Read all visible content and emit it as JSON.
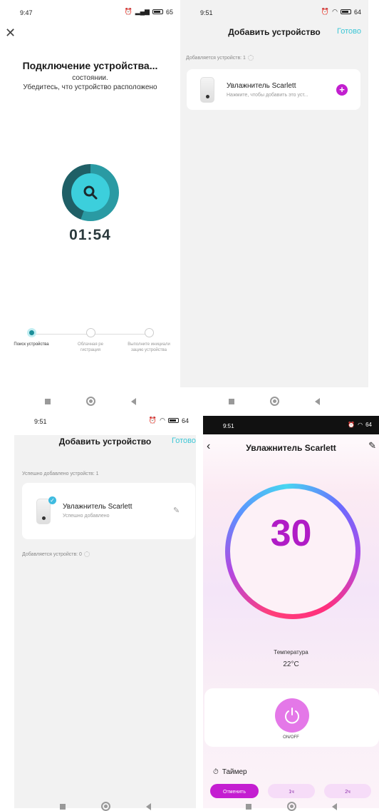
{
  "screen1": {
    "status_time": "9:47",
    "status_battery": "65",
    "title": "Подключение устройства...",
    "subtitle_line1": "состоянии.",
    "subtitle_line2": "Убедитесь, что устройство расположено",
    "countdown": "01:54",
    "steps": [
      {
        "label": "Поиск устройства",
        "state": "active"
      },
      {
        "label": "Облачная ре гистрация",
        "state": "pending"
      },
      {
        "label": "Выполните инициали зацию устройства",
        "state": "pending"
      }
    ]
  },
  "screen2": {
    "status_time": "9:51",
    "status_battery": "64",
    "header_title": "Добавить устройство",
    "done_label": "Готово",
    "adding_label": "Добавляется устройств: 1",
    "device_name": "Увлажнитель Scarlett",
    "device_hint": "Нажмите, чтобы добавить это уст...",
    "add_icon": "plus-icon"
  },
  "screen3": {
    "status_time": "9:51",
    "status_battery": "64",
    "header_title": "Добавить устройство",
    "done_label": "Готово",
    "success_label": "Успешно добавлено устройств: 1",
    "device_name": "Увлажнитель Scarlett",
    "device_status": "Успешно добавлено",
    "adding_label": "Добавляется устройств: 0"
  },
  "screen4": {
    "status_time": "9:51",
    "status_battery": "64",
    "title": "Увлажнитель Scarlett",
    "humidity_value": "30",
    "temp_label": "Температура",
    "temp_value": "22°C",
    "power_label": "ON/OFF",
    "timer_label": "Таймер",
    "timer_options": [
      "Отменить",
      "1ч",
      "2ч"
    ],
    "accent_color": "#c41ed1"
  }
}
